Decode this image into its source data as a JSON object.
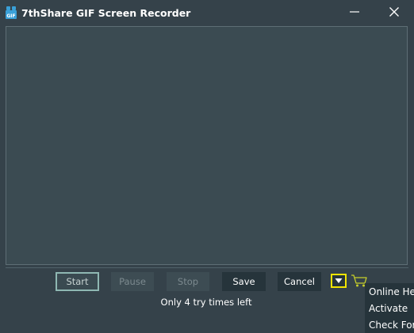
{
  "window": {
    "title": "7thShare GIF Screen Recorder",
    "app_icon": "gif-app-icon",
    "minimize_icon": "minimize-icon",
    "close_icon": "close-icon"
  },
  "controls": {
    "start_label": "Start",
    "pause_label": "Pause",
    "stop_label": "Stop",
    "save_label": "Save",
    "cancel_label": "Cancel",
    "menu_toggle_icon": "triangle-down-icon",
    "cart_icon": "shopping-cart-icon"
  },
  "status": {
    "try_text": "Only 4 try times left"
  },
  "dropdown_menu": {
    "items": [
      {
        "label": "Online Help"
      },
      {
        "label": "Activate"
      },
      {
        "label": "Check For Update"
      }
    ]
  },
  "colors": {
    "window_bg": "#35424a",
    "capture_bg": "#3b4b52",
    "dark_button": "#26343b",
    "highlight_yellow": "#f2e400",
    "start_border": "#8fb8b3"
  }
}
